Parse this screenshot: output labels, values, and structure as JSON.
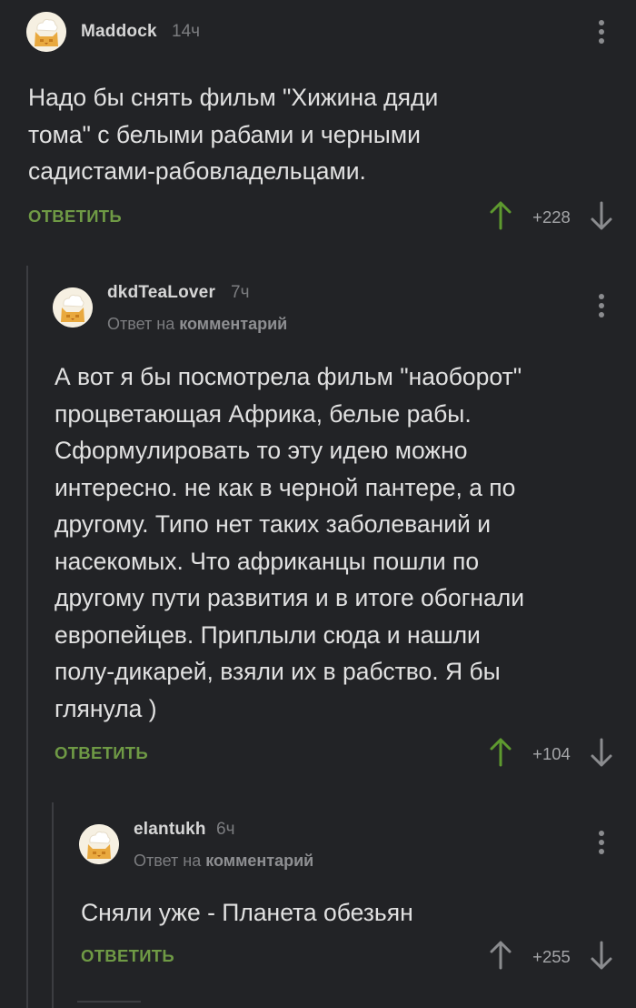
{
  "colors": {
    "background": "#222326",
    "accent_green": "#6f9a45",
    "upvote_active": "#5e9a2f",
    "text": "#e1e1e1",
    "muted": "#7c7d80"
  },
  "comments": [
    {
      "author": "Maddock",
      "time": "14ч",
      "text": "Надо бы снять фильм \"Хижина дяди\nтома\" с белыми рабами и черными\nсадистами-рабовладельцами.",
      "reply_label": "ОТВЕТИТЬ",
      "score": "+228",
      "upvoted": true,
      "avatar_icon": "chef-hat-cat-avatar",
      "upvote_icon": "arrow-up-icon",
      "downvote_icon": "arrow-down-icon",
      "menu_icon": "more-vertical-icon"
    },
    {
      "author": "dkdTeaLover",
      "time": "7ч",
      "reply_to_prefix": "Ответ на",
      "reply_to_target": "комментарий",
      "text": "А вот я бы посмотрела фильм \"наоборот\"\nпроцветающая Африка, белые рабы.\nСформулировать то эту идею можно\nинтересно. не как в черной пантере, а по\nдругому. Типо нет таких заболеваний и\nнасекомых. Что африканцы пошли по\nдругому пути развития и в итоге обогнали\nевропейцев. Приплыли сюда и нашли\nполу-дикарей, взяли их в рабство. Я бы\nглянула )",
      "reply_label": "ОТВЕТИТЬ",
      "score": "+104",
      "upvoted": true,
      "avatar_icon": "chef-hat-cat-avatar",
      "upvote_icon": "arrow-up-icon",
      "downvote_icon": "arrow-down-icon",
      "menu_icon": "more-vertical-icon"
    },
    {
      "author": "elantukh",
      "time": "6ч",
      "reply_to_prefix": "Ответ на",
      "reply_to_target": "комментарий",
      "text": "Сняли уже - Планета обезьян",
      "reply_label": "ОТВЕТИТЬ",
      "score": "+255",
      "upvoted": false,
      "avatar_icon": "chef-hat-cat-avatar",
      "upvote_icon": "arrow-up-icon",
      "downvote_icon": "arrow-down-icon",
      "menu_icon": "more-vertical-icon"
    }
  ]
}
